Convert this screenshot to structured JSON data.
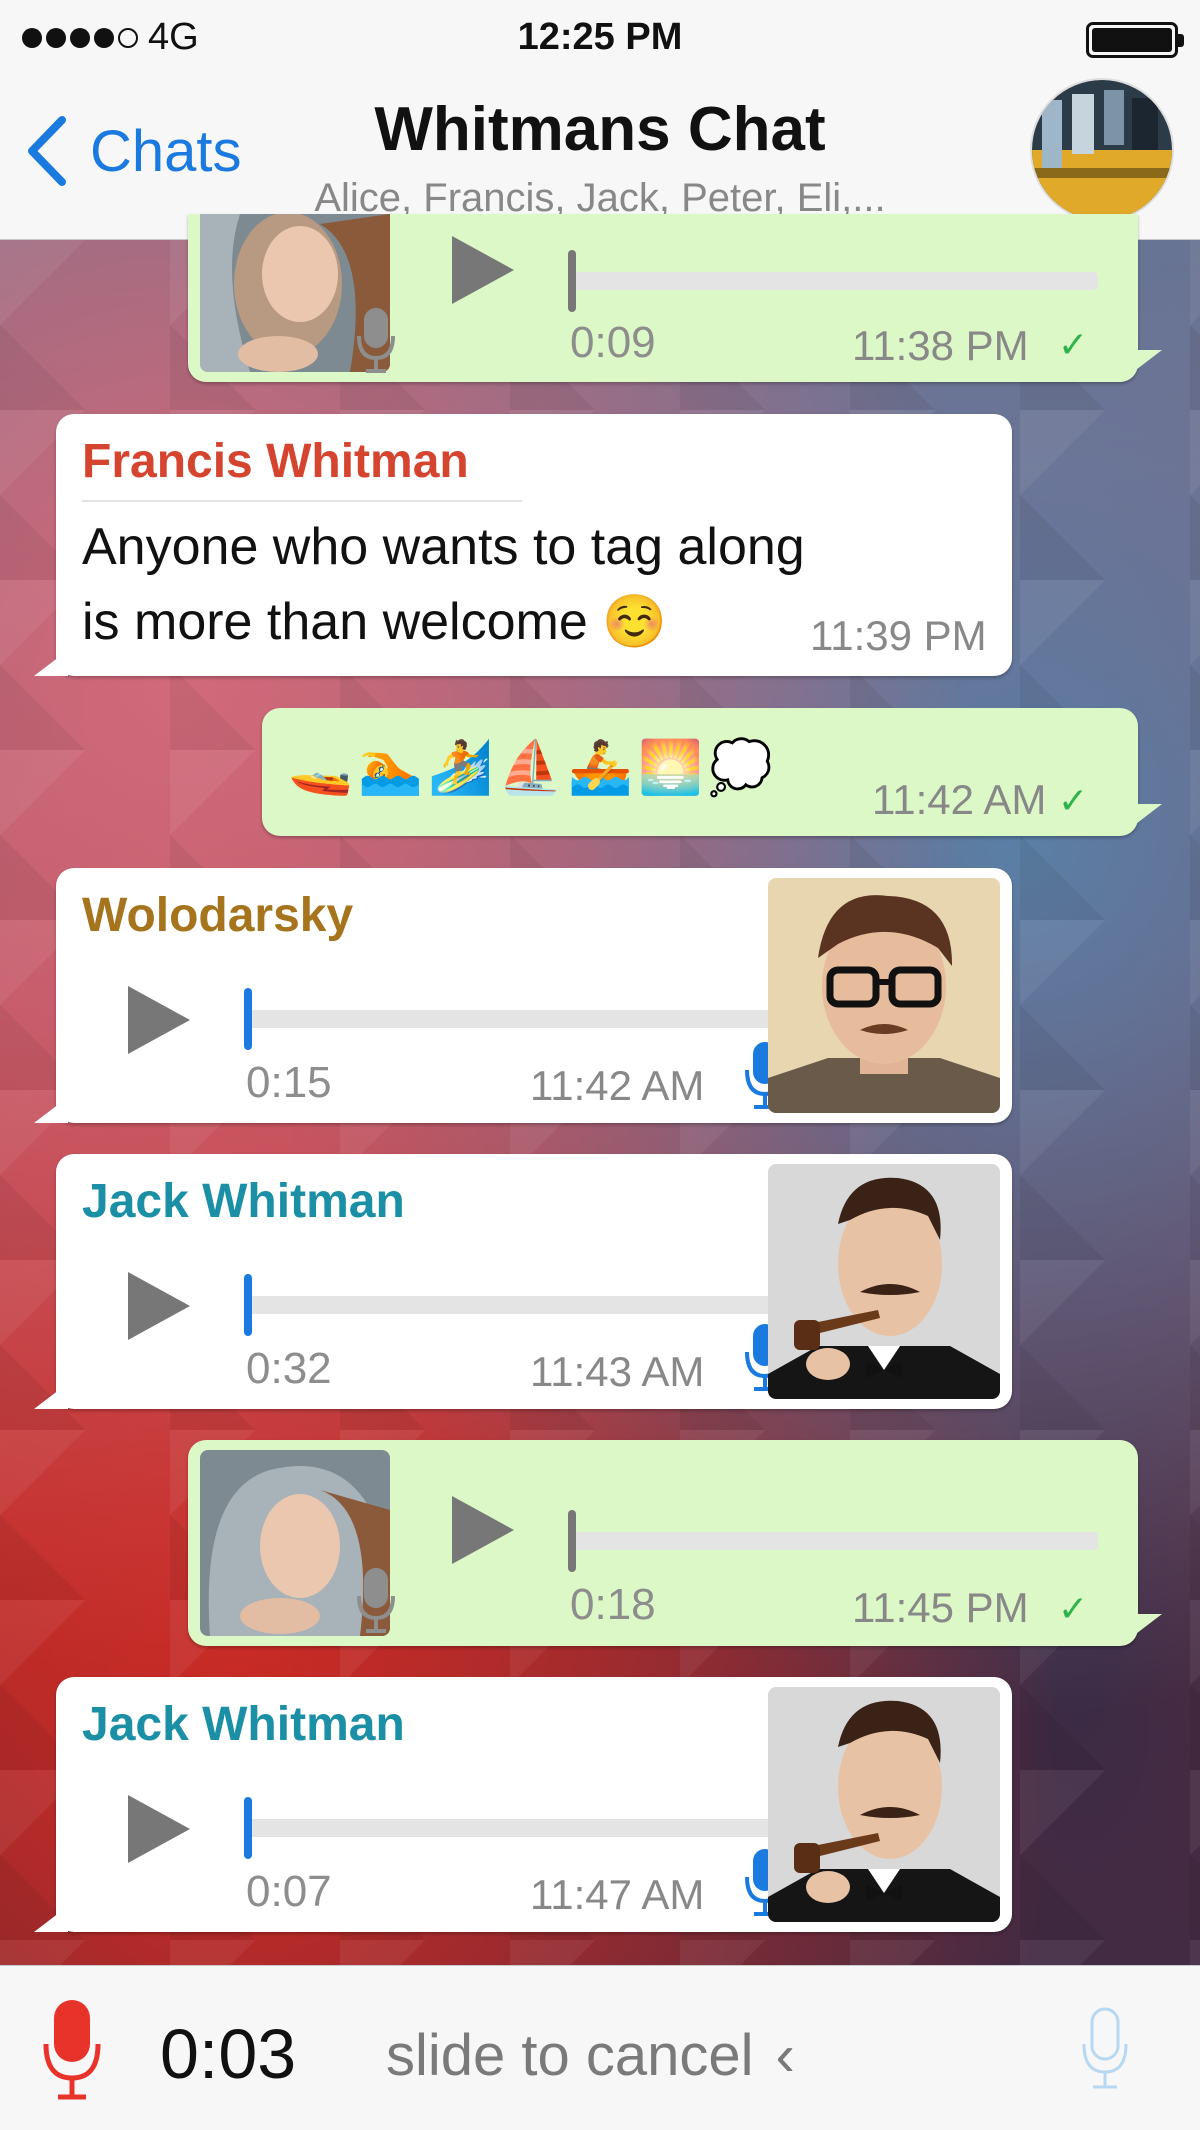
{
  "status_bar": {
    "carrier": "4G",
    "time": "12:25 PM"
  },
  "nav": {
    "back_label": "Chats",
    "title": "Whitmans Chat",
    "subtitle": "Alice, Francis, Jack, Peter, Eli,..."
  },
  "colors": {
    "outgoing_bubble": "#dcf8c6",
    "incoming_bubble": "#ffffff",
    "ios_blue": "#1a7ae0",
    "francis_name": "#d4442f",
    "wolodarsky_name": "#a5741d",
    "jack_name": "#1a8fa5",
    "record_red": "#e8332a",
    "check_green": "#2fb34a"
  },
  "messages": [
    {
      "type": "voice",
      "direction": "outgoing",
      "duration": "0:09",
      "time": "11:38 PM",
      "delivered": "✓",
      "progress": 0.0
    },
    {
      "type": "text",
      "direction": "incoming",
      "sender": "Francis Whitman",
      "line1": "Anyone who wants to tag along",
      "line2": "is more than welcome",
      "emoji": "☺️",
      "time": "11:39 PM"
    },
    {
      "type": "emoji",
      "direction": "outgoing",
      "emojis": [
        "🚤",
        "🏊",
        "🏄",
        "⛵",
        "🚣",
        "🌅",
        "💭"
      ],
      "time": "11:42 AM",
      "delivered": "✓"
    },
    {
      "type": "voice",
      "direction": "incoming",
      "sender": "Wolodarsky",
      "duration": "0:15",
      "time": "11:42 AM",
      "progress": 0.0
    },
    {
      "type": "voice",
      "direction": "incoming",
      "sender": "Jack Whitman",
      "duration": "0:32",
      "time": "11:43 AM",
      "progress": 0.0
    },
    {
      "type": "voice",
      "direction": "outgoing",
      "duration": "0:18",
      "time": "11:45 PM",
      "delivered": "✓",
      "progress": 0.0
    },
    {
      "type": "voice",
      "direction": "incoming",
      "sender": "Jack Whitman",
      "duration": "0:07",
      "time": "11:47 AM",
      "progress": 0.0
    }
  ],
  "recording": {
    "timer": "0:03",
    "slide_text": "slide to cancel",
    "chevron": "‹"
  },
  "icons": {
    "back": "chevron-left-icon",
    "mic": "microphone-icon",
    "play": "play-icon"
  }
}
